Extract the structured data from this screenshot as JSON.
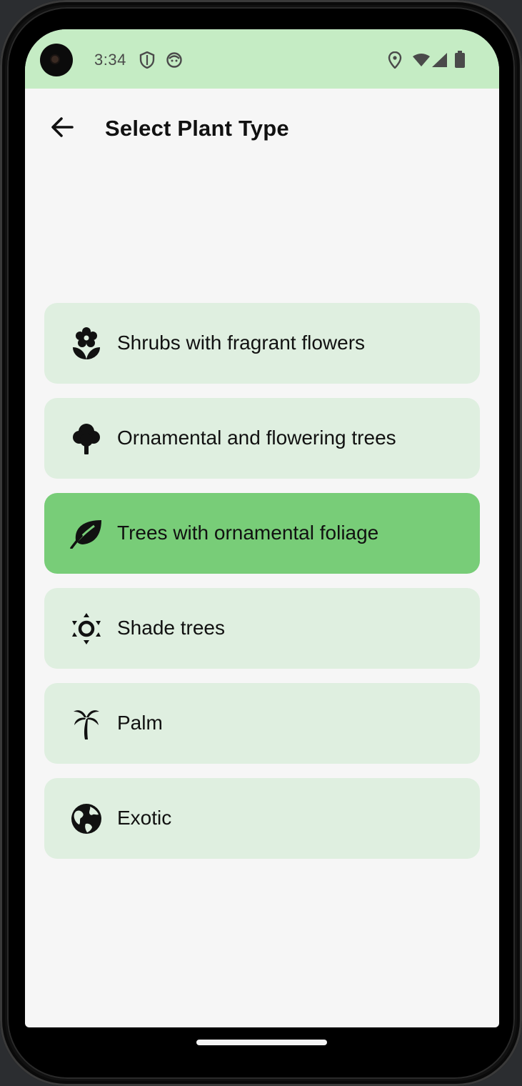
{
  "status_bar": {
    "time": "3:34",
    "icons": [
      "shield-icon",
      "face-icon",
      "location-icon",
      "wifi-icon",
      "signal-icon",
      "battery-icon"
    ]
  },
  "app_bar": {
    "back_icon": "arrow-back-icon",
    "title": "Select Plant Type"
  },
  "plant_types": [
    {
      "label": "Shrubs with fragrant flowers",
      "icon": "flower-icon",
      "selected": false
    },
    {
      "label": "Ornamental and flowering trees",
      "icon": "tree-icon",
      "selected": false
    },
    {
      "label": "Trees with ornamental foliage",
      "icon": "leaf-icon",
      "selected": true
    },
    {
      "label": "Shade trees",
      "icon": "sun-shade-icon",
      "selected": false
    },
    {
      "label": "Palm",
      "icon": "palm-icon",
      "selected": false
    },
    {
      "label": "Exotic",
      "icon": "globe-icon",
      "selected": false
    }
  ],
  "colors": {
    "status_bar": "#c5ecc4",
    "item_background": "#dfefe0",
    "item_selected": "#78cd78",
    "screen_background": "#f6f6f6"
  }
}
